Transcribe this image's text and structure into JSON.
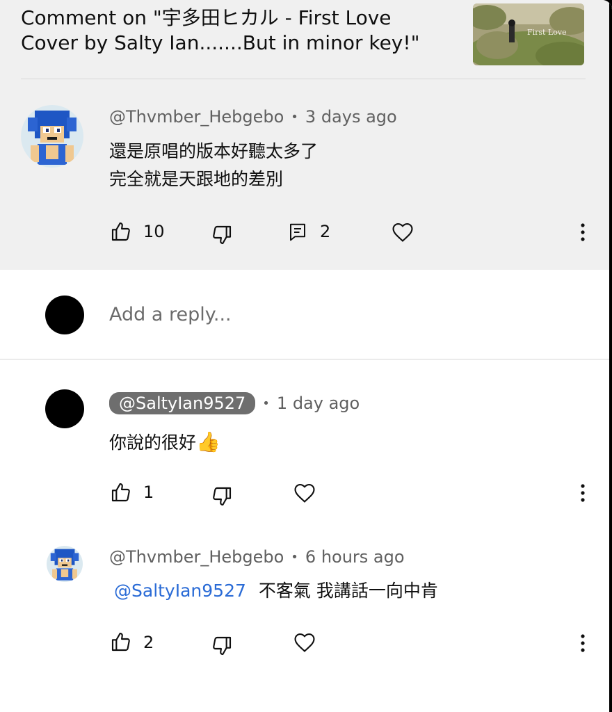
{
  "header": {
    "video_title_line1": "Comment on \"宇多田ヒカル - First Love",
    "video_title_line2": "Cover by Salty Ian.......But in minor key!\"",
    "thumbnail_text": "First Love"
  },
  "main_comment": {
    "author": "@Thvmber_Hebgebo",
    "time": "3 days ago",
    "line1": "還是原唱的版本好聽太多了",
    "line2": "完全就是天跟地的差別",
    "likes": "10",
    "replies": "2"
  },
  "reply_box": {
    "placeholder": "Add a reply..."
  },
  "replies": [
    {
      "author": "@SaltyIan9527",
      "time": "1 day ago",
      "text": "你說的很好",
      "emoji": "👍",
      "likes": "1"
    },
    {
      "author": "@Thvmber_Hebgebo",
      "time": "6 hours ago",
      "mention": "@SaltyIan9527",
      "text": "不客氣 我講話一向中肯",
      "likes": "2"
    }
  ],
  "separator": "•",
  "colors": {
    "header_bg": "#f0f0f0",
    "mention": "#2a6bd6",
    "chip_bg": "#6e6e6e",
    "meta": "#606060"
  },
  "icons": [
    "thumbs-up-icon",
    "thumbs-down-icon",
    "reply-icon",
    "heart-icon",
    "more-vertical-icon"
  ]
}
